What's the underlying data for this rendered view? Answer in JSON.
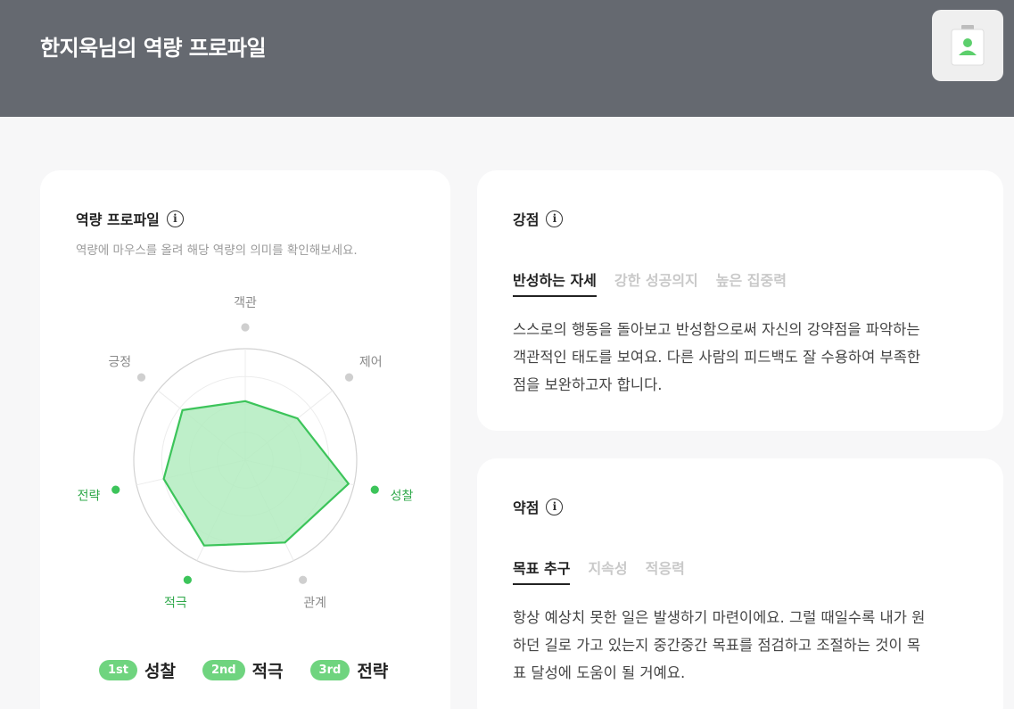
{
  "header": {
    "title": "한지욱님의 역량 프로파일",
    "profile_icon": "id-badge-icon"
  },
  "profile_card": {
    "title": "역량 프로파일",
    "subtitle": "역량에 마우스를 올려 해당 역량의 의미를 확인해보세요.",
    "axes": [
      {
        "label": "객관",
        "value": 0.53,
        "highlight": false
      },
      {
        "label": "제어",
        "value": 0.6,
        "highlight": false
      },
      {
        "label": "성찰",
        "value": 0.95,
        "highlight": true
      },
      {
        "label": "관계",
        "value": 0.82,
        "highlight": false
      },
      {
        "label": "적극",
        "value": 0.85,
        "highlight": true
      },
      {
        "label": "전략",
        "value": 0.75,
        "highlight": true
      },
      {
        "label": "긍정",
        "value": 0.72,
        "highlight": false
      }
    ],
    "ranks": [
      {
        "badge": "1st",
        "label": "성찰"
      },
      {
        "badge": "2nd",
        "label": "적극"
      },
      {
        "badge": "3rd",
        "label": "전략"
      }
    ]
  },
  "strength": {
    "title": "강점",
    "tabs": [
      "반성하는 자세",
      "강한 성공의지",
      "높은 집중력"
    ],
    "active_tab": 0,
    "lines": [
      "스스로의 행동을 돌아보고 반성함으로써 자신의 강약점을 파악하는",
      "객관적인 태도를 보여요. 다른 사람의 피드백도 잘 수용하여 부족한",
      "점을 보완하고자 합니다."
    ]
  },
  "weakness": {
    "title": "약점",
    "tabs": [
      "목표 추구",
      "지속성",
      "적응력"
    ],
    "active_tab": 0,
    "lines": [
      "항상 예상치 못한 일은 발생하기 마련이에요. 그럴 때일수록 내가 원",
      "하던 길로 가고 있는지 중간중간 목표를 점검하고 조절하는 것이 목",
      "표 달성에 도움이 될 거예요."
    ]
  },
  "colors": {
    "header": "#656970",
    "accent": "#3cc45a",
    "fill": "#b3ecbf",
    "muted_dot": "#cfcfcf"
  }
}
